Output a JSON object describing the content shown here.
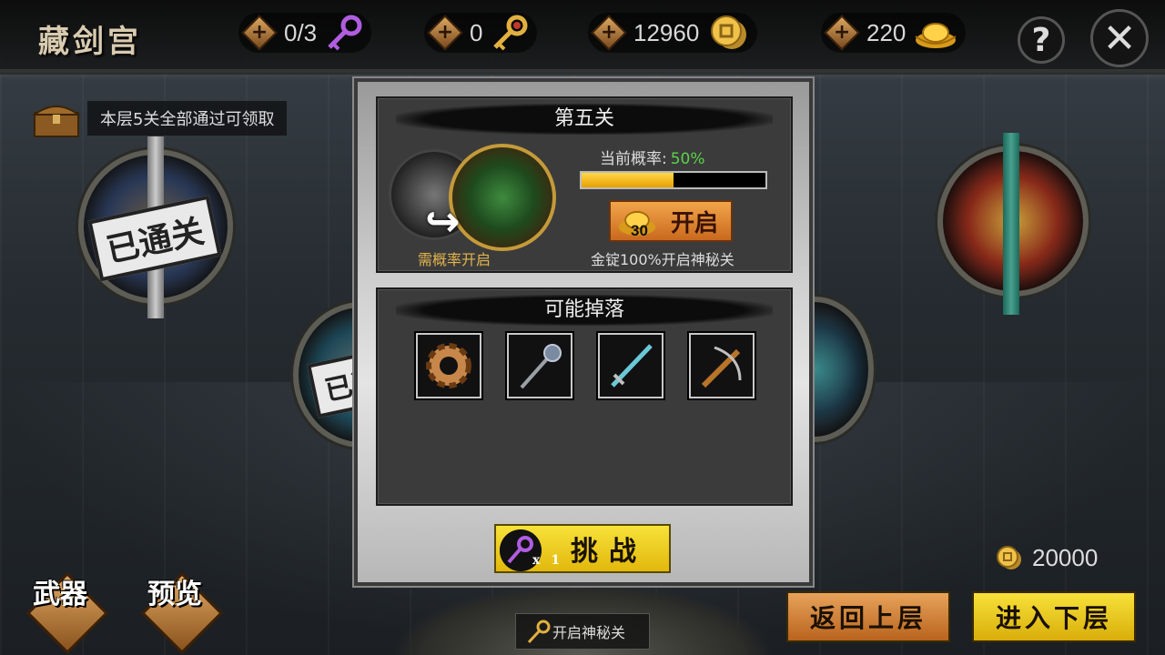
{
  "header": {
    "title": "藏剑宫",
    "resources": [
      {
        "icon": "purple-key-icon",
        "value": "0/3"
      },
      {
        "icon": "gold-key-icon",
        "value": "0"
      },
      {
        "icon": "coin-icon",
        "value": "12960"
      },
      {
        "icon": "gold-ingot-icon",
        "value": "220"
      }
    ],
    "help_label": "?",
    "close_label": "✕"
  },
  "floor_reward": {
    "text": "本层5关全部通过可领取"
  },
  "stages": {
    "cleared_stamp": "已通关"
  },
  "modal": {
    "stage_title": "第五关",
    "need_probability_label": "需概率开启",
    "probability": {
      "label": "当前概率:",
      "value": "50%",
      "fraction": 0.5
    },
    "open_button": {
      "label": "开启",
      "ingot_cost": "30"
    },
    "open_desc": "金锭100%开启神秘关",
    "drops": {
      "title": "可能掉落",
      "items": [
        {
          "name": "gear"
        },
        {
          "name": "mace"
        },
        {
          "name": "sword"
        },
        {
          "name": "crossbow"
        }
      ]
    },
    "challenge": {
      "label": "挑战",
      "key_count": "x1"
    }
  },
  "bottom": {
    "weapon_label": "武器",
    "preview_label": "预览",
    "gold_total": "20000",
    "mystery_label": "开启神秘关",
    "back_label": "返回上层",
    "next_label": "进入下层"
  },
  "colors": {
    "accent_gold": "#f2d02a",
    "accent_copper": "#d98a3a",
    "probability_green": "#5bd34a"
  }
}
